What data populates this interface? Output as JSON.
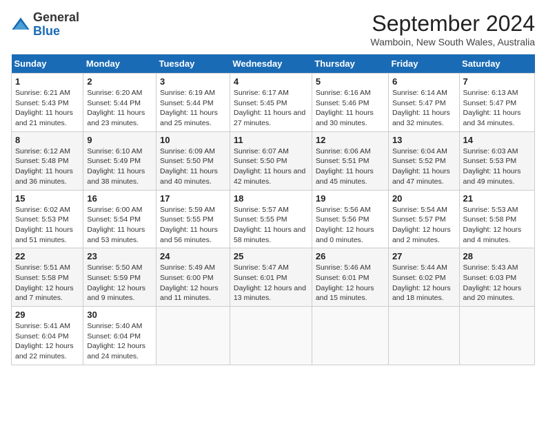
{
  "header": {
    "logo_line1": "General",
    "logo_line2": "Blue",
    "month": "September 2024",
    "location": "Wamboin, New South Wales, Australia"
  },
  "days_of_week": [
    "Sunday",
    "Monday",
    "Tuesday",
    "Wednesday",
    "Thursday",
    "Friday",
    "Saturday"
  ],
  "weeks": [
    [
      {
        "day": "1",
        "sunrise": "6:21 AM",
        "sunset": "5:43 PM",
        "daylight": "11 hours and 21 minutes."
      },
      {
        "day": "2",
        "sunrise": "6:20 AM",
        "sunset": "5:44 PM",
        "daylight": "11 hours and 23 minutes."
      },
      {
        "day": "3",
        "sunrise": "6:19 AM",
        "sunset": "5:44 PM",
        "daylight": "11 hours and 25 minutes."
      },
      {
        "day": "4",
        "sunrise": "6:17 AM",
        "sunset": "5:45 PM",
        "daylight": "11 hours and 27 minutes."
      },
      {
        "day": "5",
        "sunrise": "6:16 AM",
        "sunset": "5:46 PM",
        "daylight": "11 hours and 30 minutes."
      },
      {
        "day": "6",
        "sunrise": "6:14 AM",
        "sunset": "5:47 PM",
        "daylight": "11 hours and 32 minutes."
      },
      {
        "day": "7",
        "sunrise": "6:13 AM",
        "sunset": "5:47 PM",
        "daylight": "11 hours and 34 minutes."
      }
    ],
    [
      {
        "day": "8",
        "sunrise": "6:12 AM",
        "sunset": "5:48 PM",
        "daylight": "11 hours and 36 minutes."
      },
      {
        "day": "9",
        "sunrise": "6:10 AM",
        "sunset": "5:49 PM",
        "daylight": "11 hours and 38 minutes."
      },
      {
        "day": "10",
        "sunrise": "6:09 AM",
        "sunset": "5:50 PM",
        "daylight": "11 hours and 40 minutes."
      },
      {
        "day": "11",
        "sunrise": "6:07 AM",
        "sunset": "5:50 PM",
        "daylight": "11 hours and 42 minutes."
      },
      {
        "day": "12",
        "sunrise": "6:06 AM",
        "sunset": "5:51 PM",
        "daylight": "11 hours and 45 minutes."
      },
      {
        "day": "13",
        "sunrise": "6:04 AM",
        "sunset": "5:52 PM",
        "daylight": "11 hours and 47 minutes."
      },
      {
        "day": "14",
        "sunrise": "6:03 AM",
        "sunset": "5:53 PM",
        "daylight": "11 hours and 49 minutes."
      }
    ],
    [
      {
        "day": "15",
        "sunrise": "6:02 AM",
        "sunset": "5:53 PM",
        "daylight": "11 hours and 51 minutes."
      },
      {
        "day": "16",
        "sunrise": "6:00 AM",
        "sunset": "5:54 PM",
        "daylight": "11 hours and 53 minutes."
      },
      {
        "day": "17",
        "sunrise": "5:59 AM",
        "sunset": "5:55 PM",
        "daylight": "11 hours and 56 minutes."
      },
      {
        "day": "18",
        "sunrise": "5:57 AM",
        "sunset": "5:55 PM",
        "daylight": "11 hours and 58 minutes."
      },
      {
        "day": "19",
        "sunrise": "5:56 AM",
        "sunset": "5:56 PM",
        "daylight": "12 hours and 0 minutes."
      },
      {
        "day": "20",
        "sunrise": "5:54 AM",
        "sunset": "5:57 PM",
        "daylight": "12 hours and 2 minutes."
      },
      {
        "day": "21",
        "sunrise": "5:53 AM",
        "sunset": "5:58 PM",
        "daylight": "12 hours and 4 minutes."
      }
    ],
    [
      {
        "day": "22",
        "sunrise": "5:51 AM",
        "sunset": "5:58 PM",
        "daylight": "12 hours and 7 minutes."
      },
      {
        "day": "23",
        "sunrise": "5:50 AM",
        "sunset": "5:59 PM",
        "daylight": "12 hours and 9 minutes."
      },
      {
        "day": "24",
        "sunrise": "5:49 AM",
        "sunset": "6:00 PM",
        "daylight": "12 hours and 11 minutes."
      },
      {
        "day": "25",
        "sunrise": "5:47 AM",
        "sunset": "6:01 PM",
        "daylight": "12 hours and 13 minutes."
      },
      {
        "day": "26",
        "sunrise": "5:46 AM",
        "sunset": "6:01 PM",
        "daylight": "12 hours and 15 minutes."
      },
      {
        "day": "27",
        "sunrise": "5:44 AM",
        "sunset": "6:02 PM",
        "daylight": "12 hours and 18 minutes."
      },
      {
        "day": "28",
        "sunrise": "5:43 AM",
        "sunset": "6:03 PM",
        "daylight": "12 hours and 20 minutes."
      }
    ],
    [
      {
        "day": "29",
        "sunrise": "5:41 AM",
        "sunset": "6:04 PM",
        "daylight": "12 hours and 22 minutes."
      },
      {
        "day": "30",
        "sunrise": "5:40 AM",
        "sunset": "6:04 PM",
        "daylight": "12 hours and 24 minutes."
      },
      null,
      null,
      null,
      null,
      null
    ]
  ]
}
